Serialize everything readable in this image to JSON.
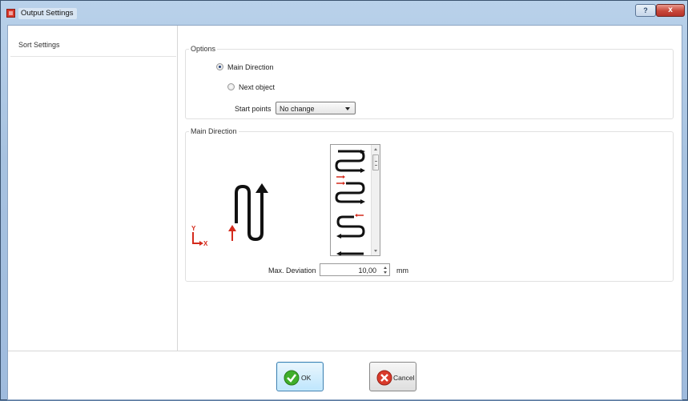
{
  "window": {
    "title": "Output Settings",
    "help_label": "?",
    "close_label": "x"
  },
  "nav": {
    "items": [
      {
        "label": "Sort Settings"
      }
    ]
  },
  "options": {
    "legend": "Options",
    "radio_main_direction": {
      "label": "Main Direction",
      "checked": true
    },
    "radio_next_object": {
      "label": "Next object",
      "checked": false
    },
    "start_points": {
      "label": "Start points",
      "value": "No change"
    }
  },
  "main_direction": {
    "legend": "Main Direction",
    "axis_y_label": "Y",
    "axis_x_label": "X",
    "max_deviation": {
      "label": "Max. Deviation",
      "value": "10,00",
      "unit": "mm"
    }
  },
  "buttons": {
    "ok_label": "OK",
    "cancel_label": "Cancel"
  },
  "colors": {
    "arrow_red": "#d42a1c",
    "accent_blue": "#3c7fb1"
  }
}
